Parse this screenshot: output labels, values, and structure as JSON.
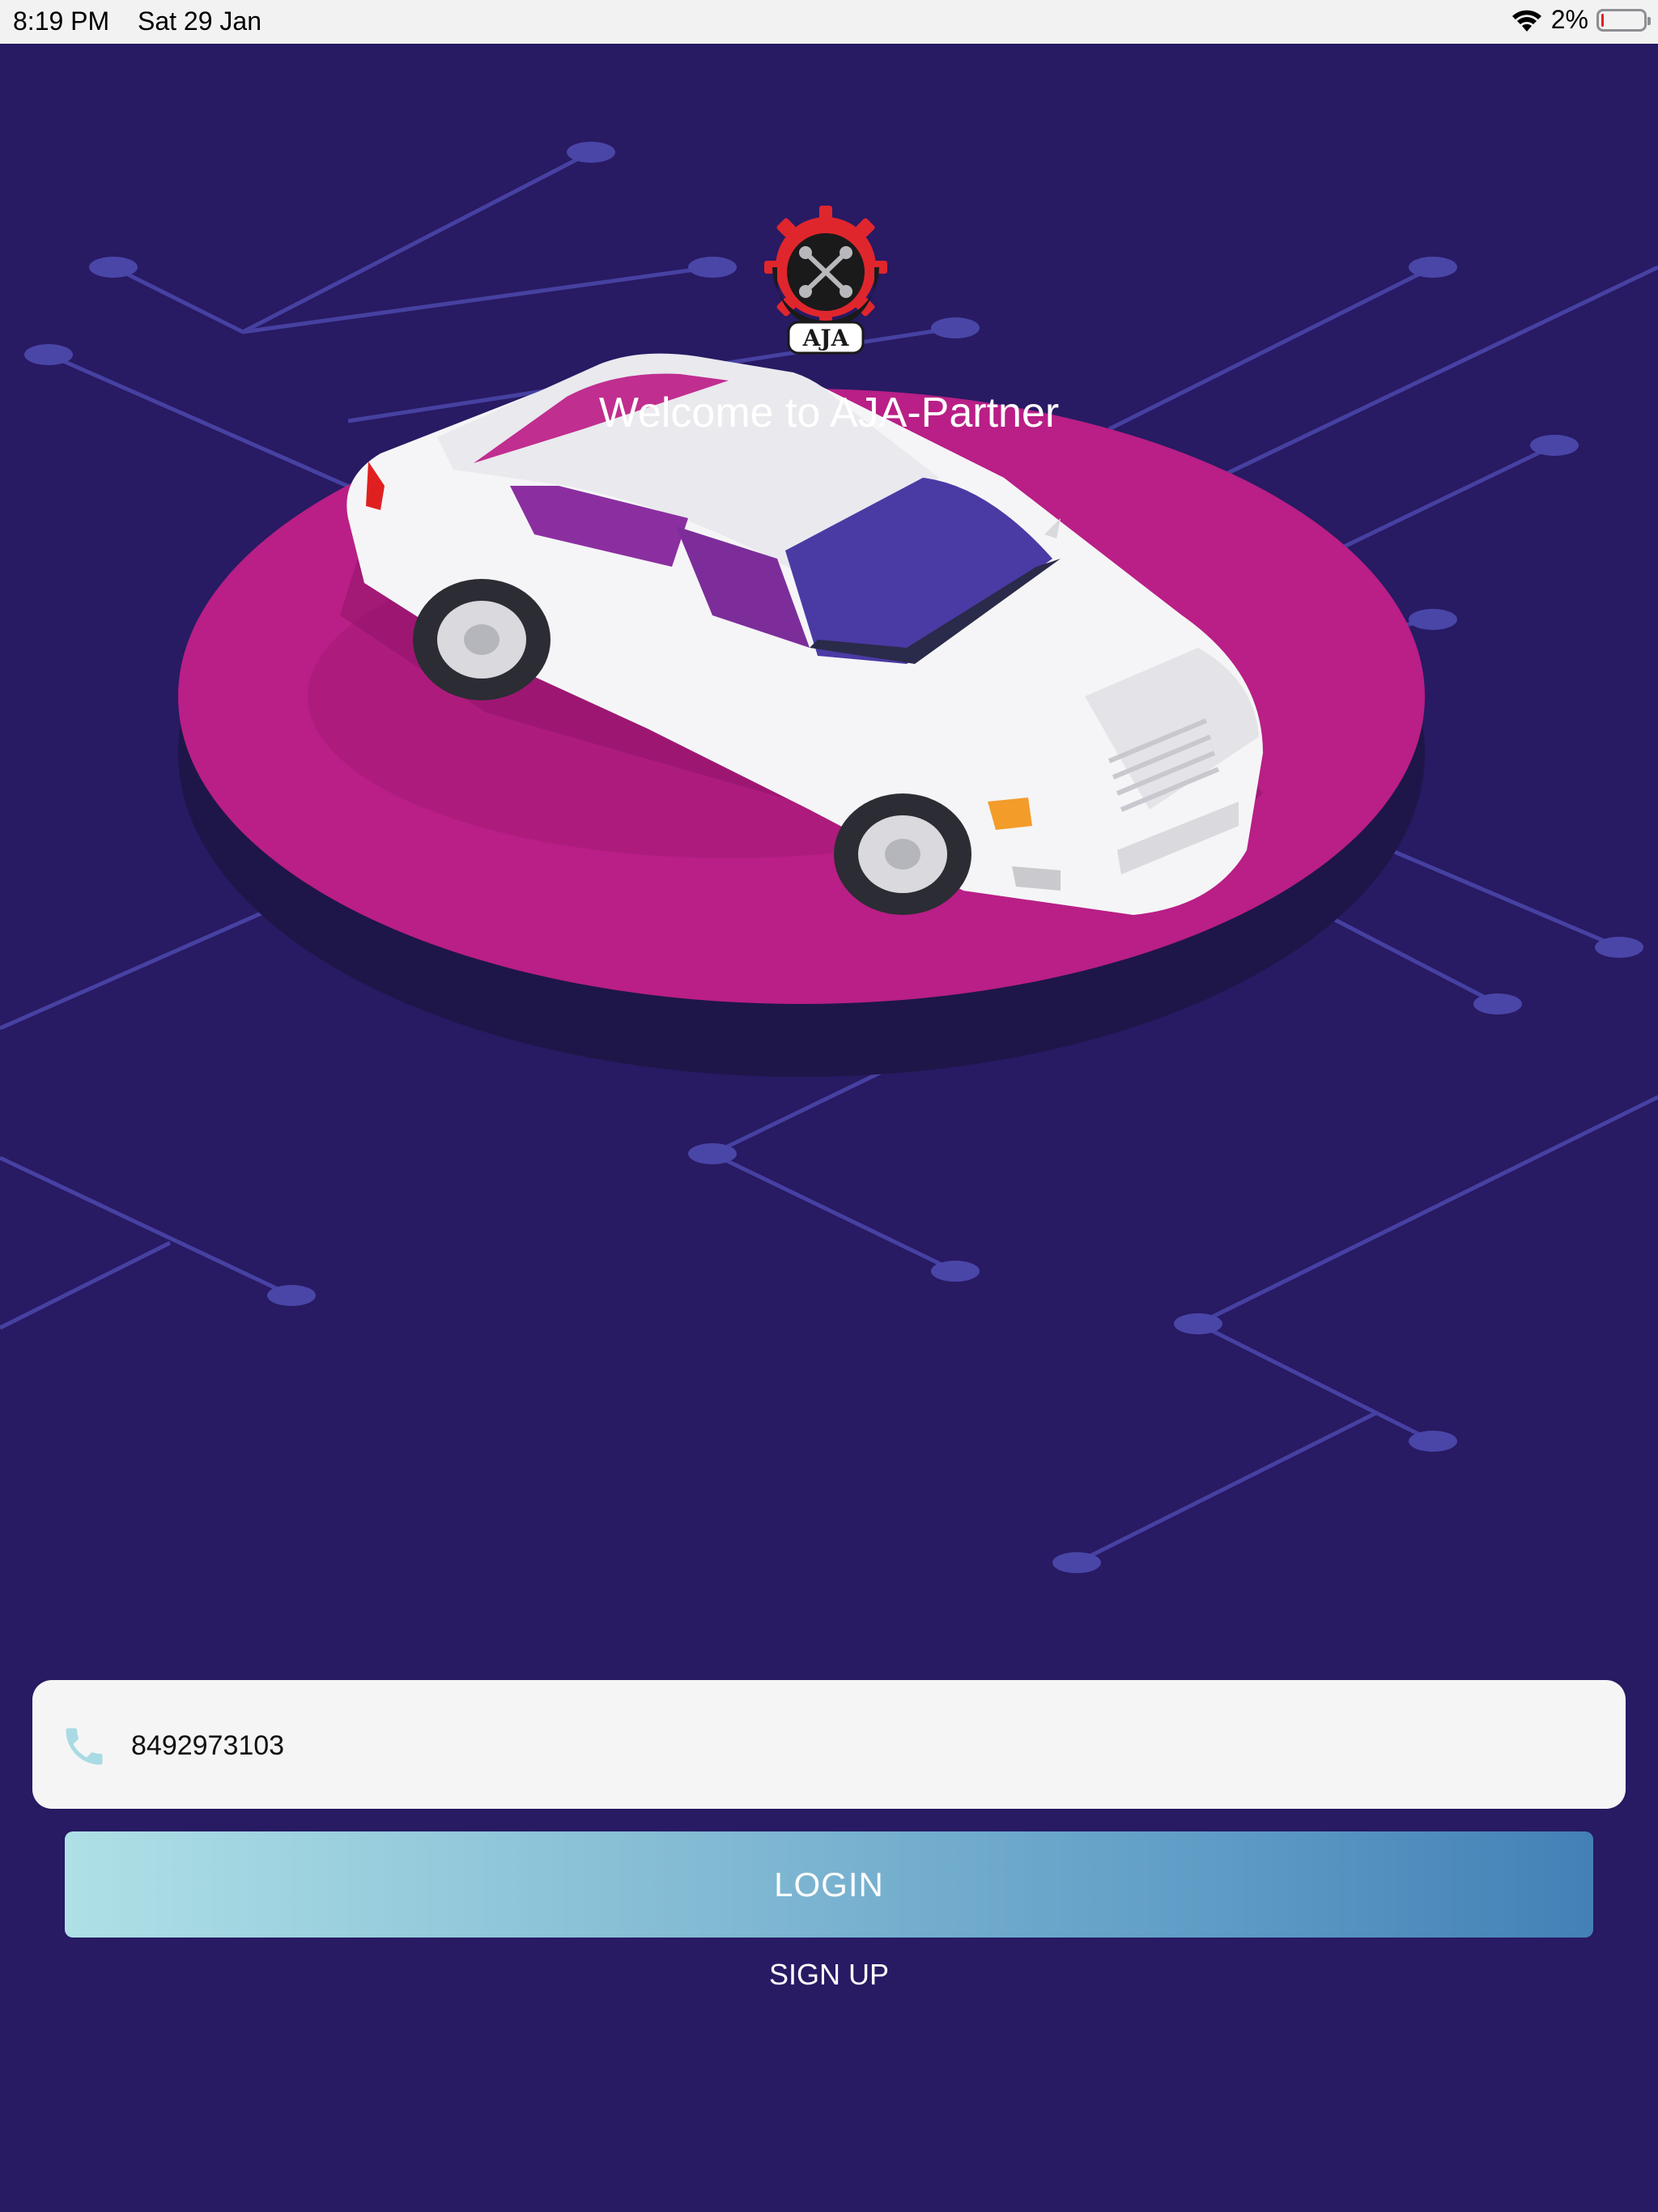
{
  "status_bar": {
    "time": "8:19 PM",
    "date": "Sat 29 Jan",
    "battery_percent": "2%",
    "battery_level": 0.02,
    "icons": [
      "wifi-icon",
      "battery-icon"
    ]
  },
  "brand": {
    "logo_text": "AJA",
    "welcome": "Welcome to AJA-Partner"
  },
  "login_form": {
    "phone_value": "8492973103",
    "login_label": "LOGIN",
    "signup_label": "SIGN UP",
    "phone_icon": "phone-icon"
  },
  "colors": {
    "background": "#281a63",
    "platform": "#b91f86",
    "field_bg": "#f5f5f5",
    "button_gradient_start": "#aee0e6",
    "button_gradient_end": "#4380b6",
    "logo_red": "#e0262d"
  }
}
